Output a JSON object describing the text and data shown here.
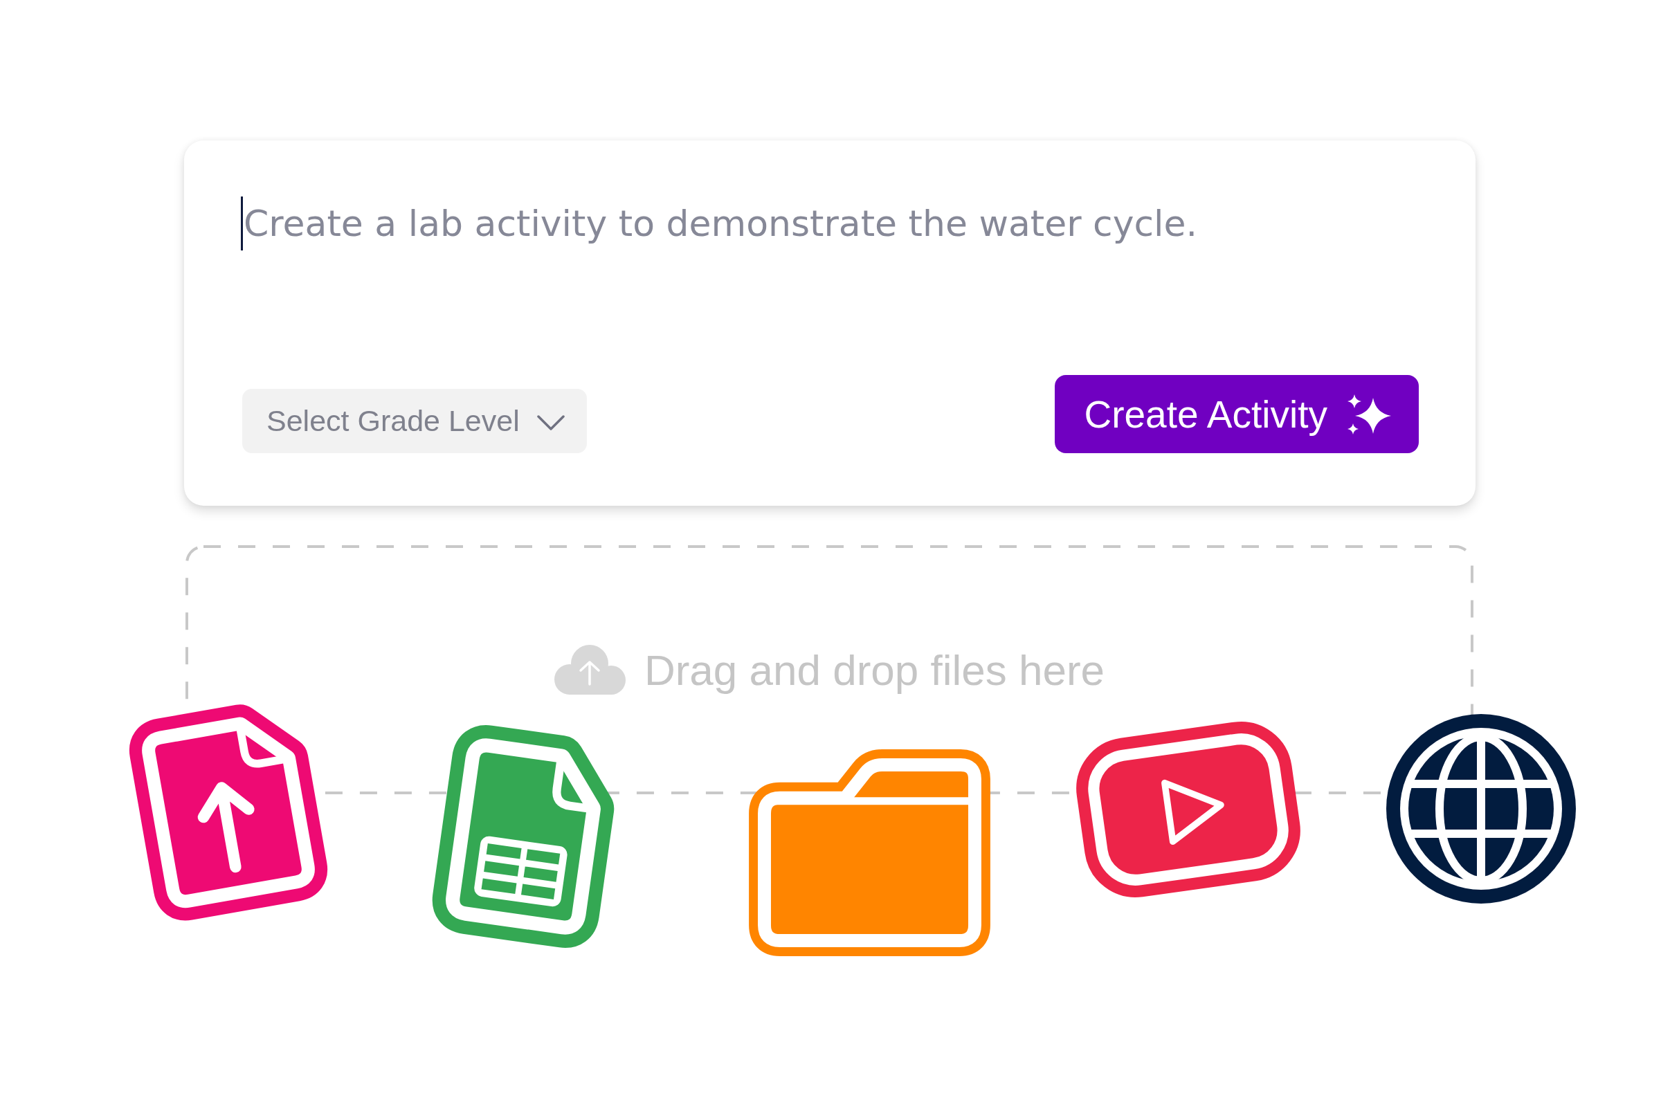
{
  "prompt": {
    "placeholder": "Create a lab activity to demonstrate the water cycle.",
    "focused": true
  },
  "grade_level": {
    "placeholder": "Select Grade Level"
  },
  "create_button": {
    "label": "Create Activity"
  },
  "drop_zone": {
    "hint": "Drag and drop files here"
  }
}
